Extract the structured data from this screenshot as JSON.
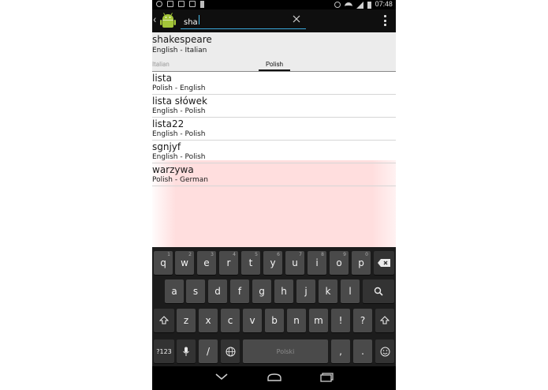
{
  "status_bar": {
    "time": "07:48"
  },
  "action_bar": {
    "search_value": "sha",
    "icons": [
      "back-chevron-icon",
      "android-app-icon",
      "clear-icon",
      "overflow-menu-icon"
    ]
  },
  "top_entry": {
    "word": "shakespeare",
    "pair": "English - Italian"
  },
  "tabs": [
    {
      "label": "Italian",
      "selected": false
    },
    {
      "label": "Polish",
      "selected": true
    }
  ],
  "list": [
    {
      "word": "lista",
      "pair": "Polish - English"
    },
    {
      "word": "lista słówek",
      "pair": "English - Polish"
    },
    {
      "word": "lista22",
      "pair": "English - Polish"
    },
    {
      "word": "sgnjyf",
      "pair": "English - Polish"
    },
    {
      "word": "warzywa",
      "pair": "Polish - German"
    }
  ],
  "keyboard": {
    "row1": [
      {
        "k": "q",
        "h": "1"
      },
      {
        "k": "w",
        "h": "2"
      },
      {
        "k": "e",
        "h": "3"
      },
      {
        "k": "r",
        "h": "4"
      },
      {
        "k": "t",
        "h": "5"
      },
      {
        "k": "y",
        "h": "6"
      },
      {
        "k": "u",
        "h": "7"
      },
      {
        "k": "i",
        "h": "8"
      },
      {
        "k": "o",
        "h": "9"
      },
      {
        "k": "p",
        "h": "0"
      }
    ],
    "row2": [
      "a",
      "s",
      "d",
      "f",
      "g",
      "h",
      "j",
      "k",
      "l"
    ],
    "row3": [
      "z",
      "x",
      "c",
      "v",
      "b",
      "n",
      "m",
      "!",
      "?"
    ],
    "sym_key": "?123",
    "space_label": "Polski",
    "comma": ",",
    "period": ".",
    "slash": "/"
  },
  "colors": {
    "accent": "#3aa8dc",
    "highlight": "#ffdede",
    "keyboard_bg": "#1c1c1c",
    "key_bg": "#4a4a4a"
  }
}
